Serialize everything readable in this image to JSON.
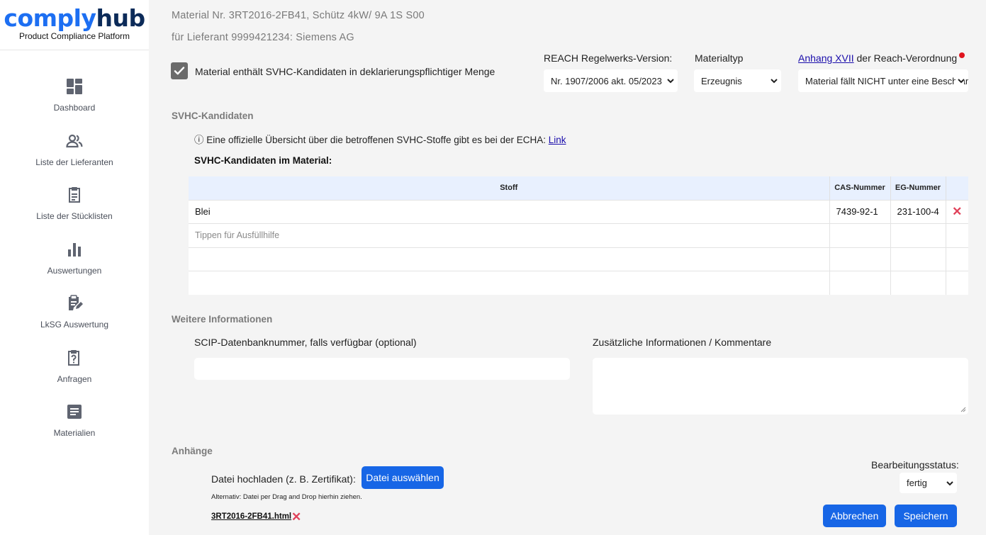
{
  "brand": {
    "name_part1": "comply",
    "name_part2": "hub",
    "tagline": "Product Compliance Platform"
  },
  "sidebar": {
    "items": [
      {
        "label": "Dashboard",
        "icon": "dashboard-icon"
      },
      {
        "label": "Liste der Lieferanten",
        "icon": "people-icon"
      },
      {
        "label": "Liste der Stücklisten",
        "icon": "clipboard-list-icon"
      },
      {
        "label": "Auswertungen",
        "icon": "bar-chart-icon"
      },
      {
        "label": "LkSG Auswertung",
        "icon": "clipboard-edit-icon"
      },
      {
        "label": "Anfragen",
        "icon": "clipboard-question-icon"
      },
      {
        "label": "Materialien",
        "icon": "document-icon"
      }
    ]
  },
  "header": {
    "material": "Material Nr. 3RT2016-2FB41, Schütz 4kW/ 9A 1S S00",
    "supplier": "für Lieferant 9999421234: Siemens AG"
  },
  "svhc_checkbox": {
    "label": "Material enthält SVHC-Kandidaten in deklarierungspflichtiger Menge",
    "checked": true
  },
  "reach_version": {
    "label": "REACH Regelwerks-Version:",
    "value": "Nr. 1907/2006 akt. 05/2023"
  },
  "material_type": {
    "label": "Materialtyp",
    "value": "Erzeugnis"
  },
  "annex": {
    "link_text": "Anhang XVII",
    "label_rest": " der Reach-Verordnung",
    "value": "Material fällt NICHT unter eine Beschränkung"
  },
  "svhc_section": {
    "title": "SVHC-Kandidaten",
    "info_prefix": "ⓘ Eine offizielle Übersicht über die betroffenen SVHC-Stoffe gibt es bei der ECHA: ",
    "info_link": "Link",
    "subtitle": "SVHC-Kandidaten im Material:",
    "table": {
      "headers": [
        "Stoff",
        "CAS-Nummer",
        "EG-Nummer"
      ],
      "rows": [
        {
          "stoff": "Blei",
          "cas": "7439-92-1",
          "eg": "231-100-4"
        }
      ],
      "placeholder": "Tippen für Ausfüllhilfe"
    }
  },
  "further_info": {
    "title": "Weitere Informationen",
    "scip_label": "SCIP-Datenbanknummer, falls verfügbar (optional)",
    "scip_value": "",
    "comments_label": "Zusätzliche Informationen / Kommentare",
    "comments_value": ""
  },
  "attachments": {
    "title": "Anhänge",
    "upload_label": "Datei hochladen (z. B. Zertifikat):",
    "upload_button": "Datei auswählen",
    "drag_note": "Alternativ: Datei per Drag and Drop hierhin ziehen.",
    "file_name": "3RT2016-2FB41.html"
  },
  "status": {
    "label": "Bearbeitungsstatus:",
    "value": "fertig"
  },
  "actions": {
    "cancel": "Abbrechen",
    "save": "Speichern"
  },
  "colors": {
    "accent": "#1766e6",
    "brand_blue": "#1d6ff2",
    "brand_navy": "#0c2b59",
    "delete_red": "#e0425a"
  }
}
